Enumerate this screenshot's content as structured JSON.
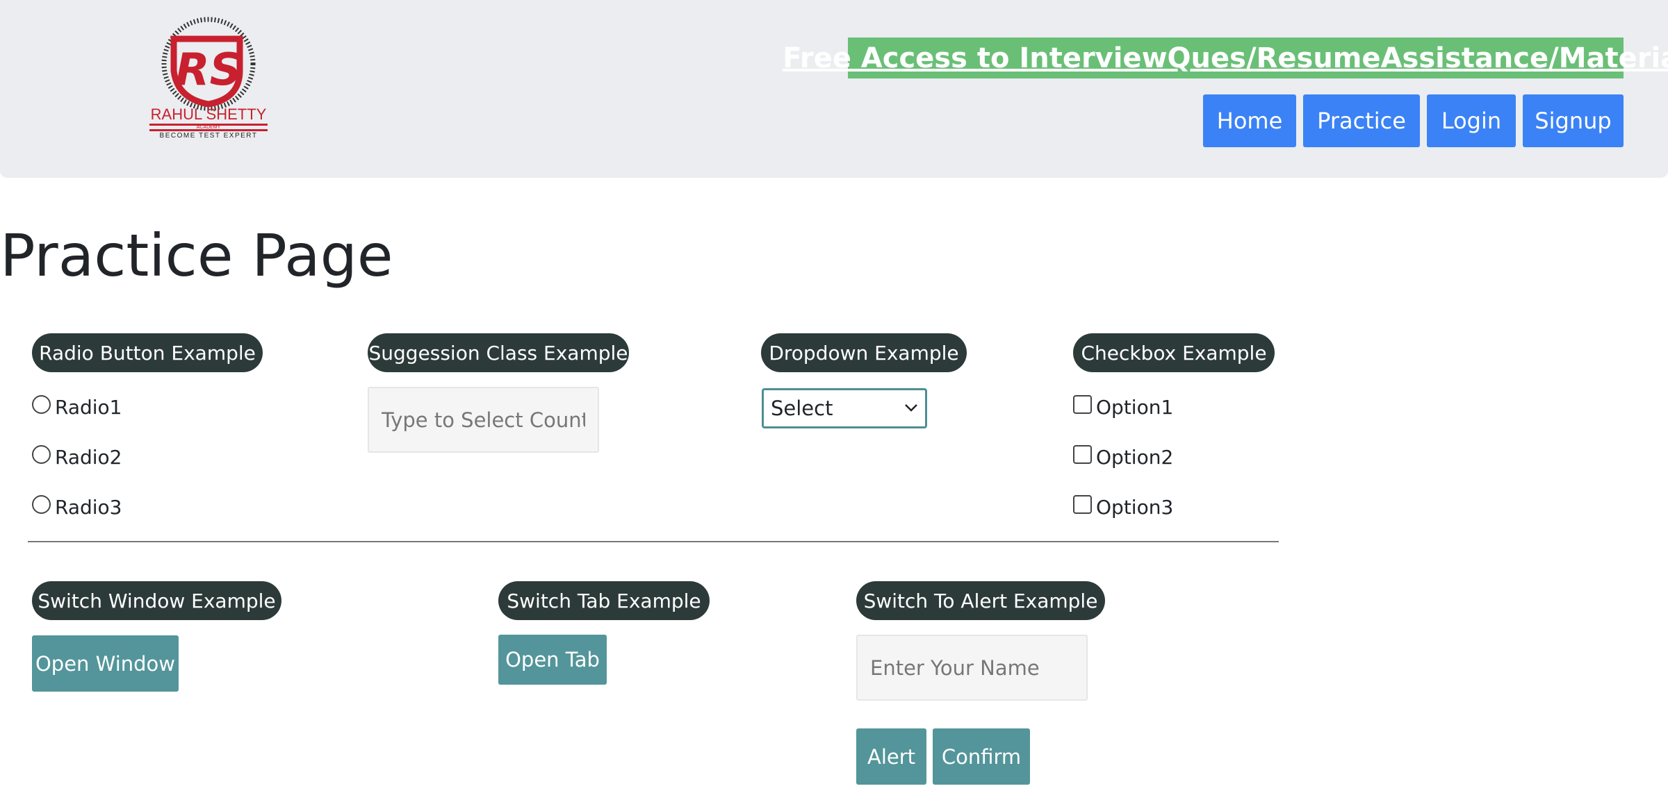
{
  "header": {
    "logo": {
      "line1": "RAHUL SHETTY",
      "line2": "ACADEMY",
      "line3": "BECOME TEST EXPERT"
    },
    "promo_link": "Free Access to InterviewQues/ResumeAssistance/Material",
    "nav": {
      "home": "Home",
      "practice": "Practice",
      "login": "Login",
      "signup": "Signup"
    }
  },
  "page_title": "Practice Page",
  "radio_section": {
    "title": "Radio Button Example",
    "options": [
      "Radio1",
      "Radio2",
      "Radio3"
    ]
  },
  "suggestion_section": {
    "title": "Suggession Class Example",
    "placeholder": "Type to Select Countries"
  },
  "dropdown_section": {
    "title": "Dropdown Example",
    "selected": "Select"
  },
  "checkbox_section": {
    "title": "Checkbox Example",
    "options": [
      "Option1",
      "Option2",
      "Option3"
    ]
  },
  "switch_window": {
    "title": "Switch Window Example",
    "button": "Open Window"
  },
  "switch_tab": {
    "title": "Switch Tab Example",
    "button": "Open Tab"
  },
  "alert_section": {
    "title": "Switch To Alert Example",
    "placeholder": "Enter Your Name",
    "alert_button": "Alert",
    "confirm_button": "Confirm"
  },
  "colors": {
    "nav_button": "#3b82f6",
    "promo_bg": "#6abf77",
    "pill_bg": "#2d3a3a",
    "teal_button": "#53959a",
    "logo_red": "#c8202f"
  }
}
